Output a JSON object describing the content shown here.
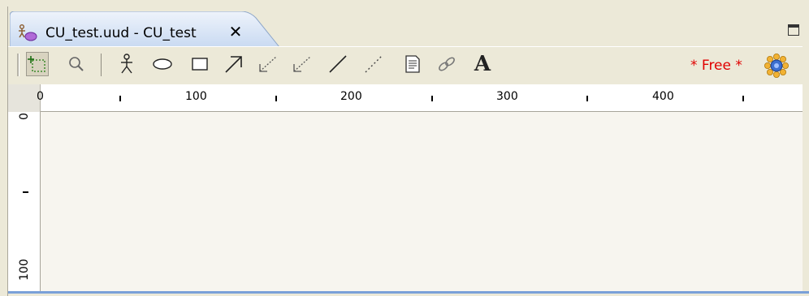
{
  "tab": {
    "title": "CU_test.uud - CU_test",
    "close_glyph": "✕",
    "icon": "uml-diagram-icon"
  },
  "view_controls": {
    "maximize_icon": "maximize-icon"
  },
  "toolbar": {
    "tools": [
      {
        "icon": "selection-tool-icon",
        "selected": true
      },
      {
        "icon": "zoom-icon"
      },
      {
        "icon": "actor-icon"
      },
      {
        "icon": "ellipse-use-case-icon"
      },
      {
        "icon": "rectangle-icon"
      },
      {
        "icon": "arrow-association-icon"
      },
      {
        "icon": "include-relation-icon"
      },
      {
        "icon": "extend-relation-icon"
      },
      {
        "icon": "line-icon"
      },
      {
        "icon": "dashed-line-icon"
      },
      {
        "icon": "note-icon"
      },
      {
        "icon": "note-link-icon"
      },
      {
        "icon": "text-tool-icon",
        "glyph": "A"
      }
    ],
    "free_label": "* Free *",
    "badge_icon": "sun-badge-icon"
  },
  "ruler": {
    "horizontal_labels": [
      "0",
      "100",
      "200",
      "300",
      "400"
    ],
    "vertical_labels": [
      "0",
      "100"
    ]
  },
  "colors": {
    "chrome": "#ece9d8",
    "canvas": "#f7f5ef",
    "free_label": "#e00000",
    "tab_fill": "#d6e3f6",
    "accent_bottom": "#7aa0d8"
  }
}
